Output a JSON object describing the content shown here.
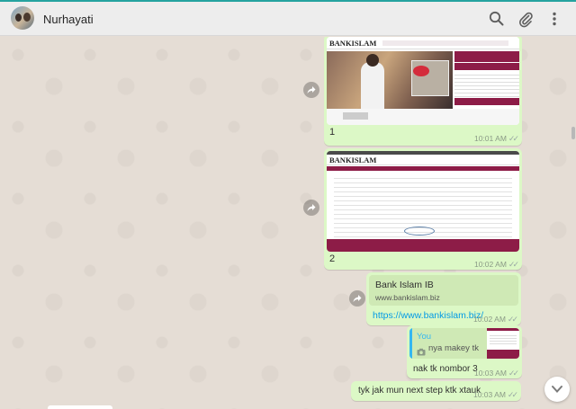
{
  "contact": {
    "name": "Nurhayati"
  },
  "icons": {
    "search": "search-icon",
    "attach": "paperclip-icon",
    "menu": "more-vertical-icon",
    "forward": "forward-icon",
    "down": "chevron-down-icon",
    "camera": "camera-icon"
  },
  "colors": {
    "bubble_out": "#dcf8c6",
    "header_bg": "#ededed",
    "chat_bg": "#e5ddd5",
    "link": "#039be5",
    "bank_maroon": "#8d1c47",
    "quote_accent": "#34b7f1"
  },
  "messages": [
    {
      "type": "image",
      "caption": "1",
      "time": "10:01 AM",
      "image_text": "BANKISLAM"
    },
    {
      "type": "image",
      "caption": "2",
      "time": "10:02 AM",
      "image_text": "BANKISLAM"
    },
    {
      "type": "link",
      "preview_title": "Bank Islam IB",
      "preview_domain": "www.bankislam.biz",
      "url": "https://www.bankislam.biz/",
      "time": "10:02 AM"
    },
    {
      "type": "reply",
      "quoted_author": "You",
      "quoted_text": "nya makey tk",
      "text": "nak tk nombor 3",
      "time": "10:03 AM"
    },
    {
      "type": "text",
      "text": "tyk jak mun next step ktk xtauk",
      "time": "10:03 AM"
    }
  ]
}
